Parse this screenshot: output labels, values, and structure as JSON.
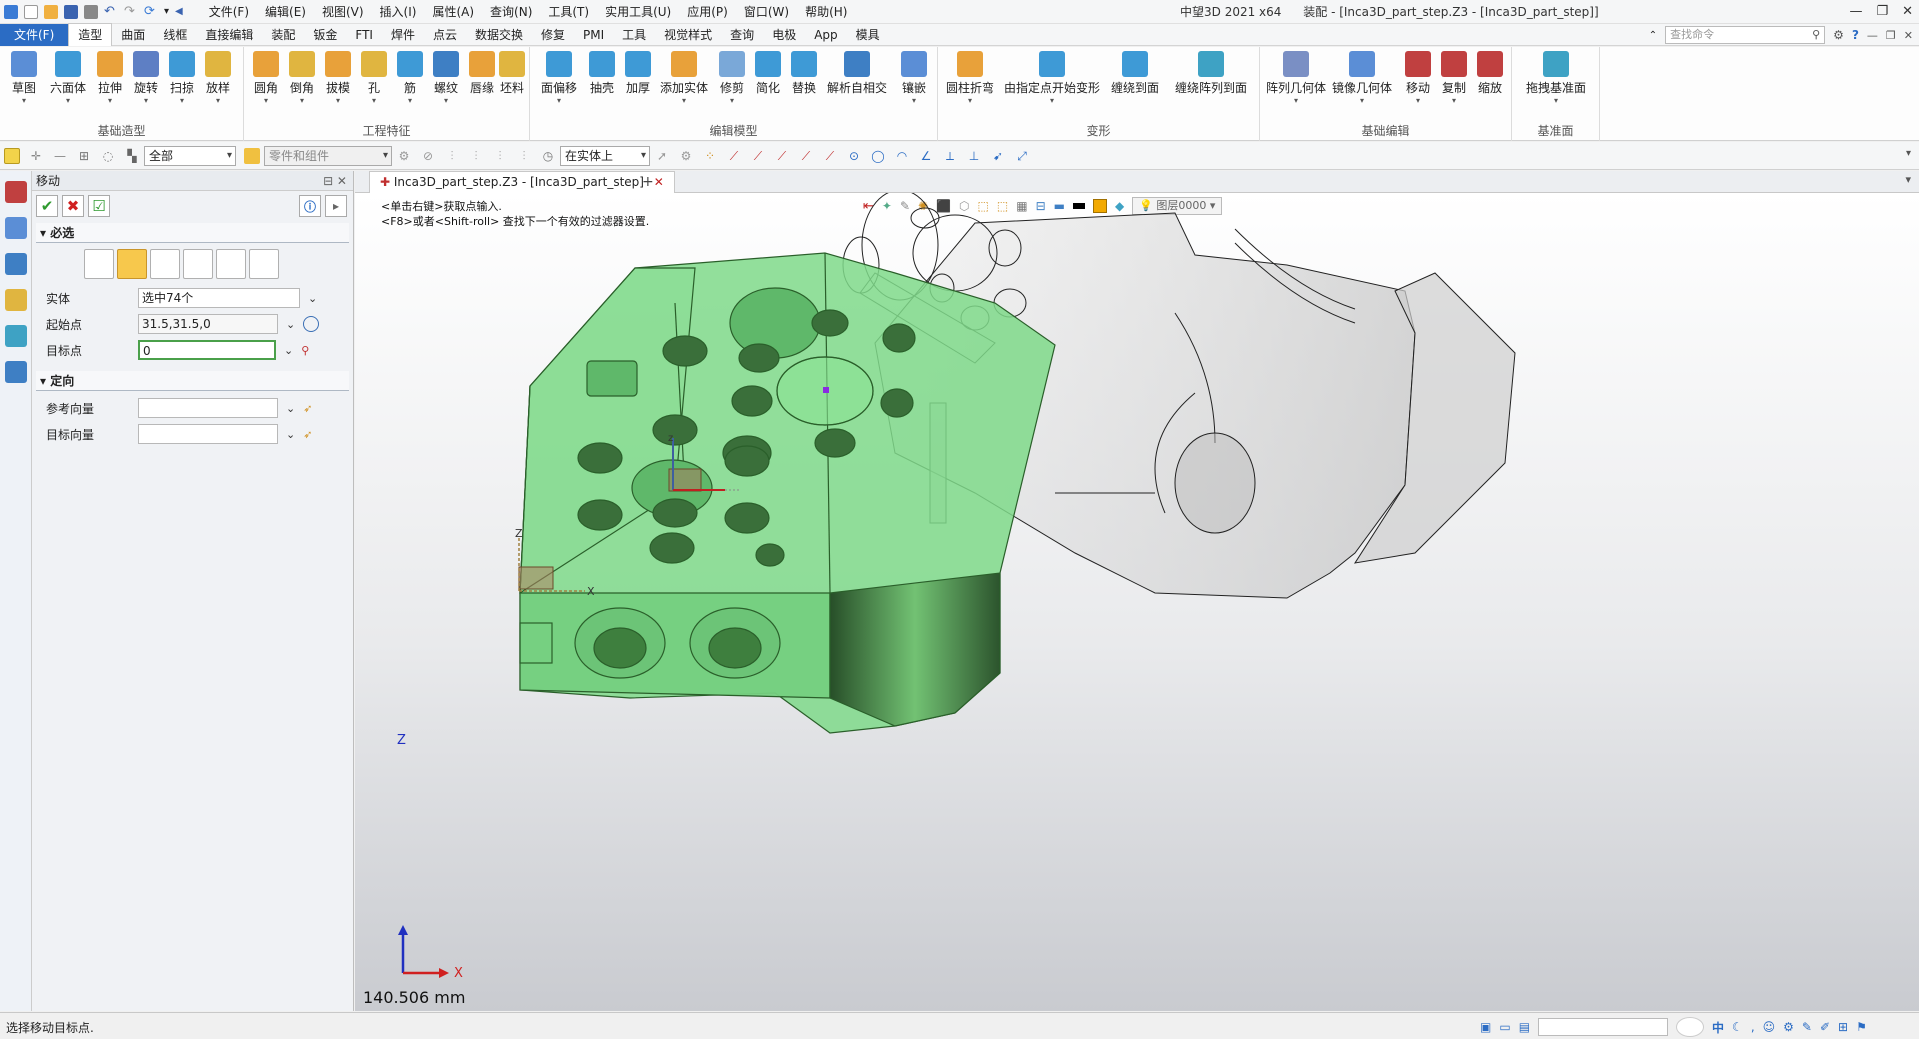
{
  "app": {
    "title": "中望3D 2021 x64",
    "context": "装配 - [Inca3D_part_step.Z3 - [Inca3D_part_step]]"
  },
  "menus": [
    "文件(F)",
    "编辑(E)",
    "视图(V)",
    "插入(I)",
    "属性(A)",
    "查询(N)",
    "工具(T)",
    "实用工具(U)",
    "应用(P)",
    "窗口(W)",
    "帮助(H)"
  ],
  "tabs": {
    "file": "文件(F)",
    "items": [
      "造型",
      "曲面",
      "线框",
      "直接编辑",
      "装配",
      "钣金",
      "FTI",
      "焊件",
      "点云",
      "数据交换",
      "修复",
      "PMI",
      "工具",
      "视觉样式",
      "查询",
      "电极",
      "App",
      "模具"
    ],
    "search_placeholder": "查找命令"
  },
  "ribbon": {
    "groups": [
      {
        "title": "基础造型",
        "buttons": [
          "草图",
          "六面体",
          "拉伸",
          "旋转",
          "扫掠",
          "放样"
        ]
      },
      {
        "title": "工程特征",
        "buttons": [
          "圆角",
          "倒角",
          "拔模",
          "孔",
          "筋",
          "螺纹",
          "唇缘",
          "坯料"
        ]
      },
      {
        "title": "编辑模型",
        "buttons": [
          "面偏移",
          "抽壳",
          "加厚",
          "添加实体",
          "修剪",
          "简化",
          "替换",
          "解析自相交",
          "镶嵌"
        ]
      },
      {
        "title": "变形",
        "buttons": [
          "圆柱折弯",
          "由指定点开始变形",
          "缠绕到面",
          "缠绕阵列到面"
        ]
      },
      {
        "title": "基础编辑",
        "buttons": [
          "阵列几何体",
          "镜像几何体",
          "移动",
          "复制",
          "缩放"
        ]
      },
      {
        "title": "基准面",
        "buttons": [
          "拖拽基准面"
        ]
      }
    ]
  },
  "toolbar2": {
    "filter": "全部",
    "parts": "零件和组件",
    "snap": "在实体上"
  },
  "panel": {
    "title": "移动",
    "required": "必选",
    "orientation": "定向",
    "fields": {
      "entity_label": "实体",
      "entity_value": "选中74个",
      "start_label": "起始点",
      "start_value": "31.5,31.5,0",
      "target_label": "目标点",
      "target_value": "0",
      "ref_vec_label": "参考向量",
      "target_vec_label": "目标向量"
    }
  },
  "doc_tab": "Inca3D_part_step.Z3 - [Inca3D_part_step]",
  "viewport": {
    "prompt1": "<单击右键>获取点输入.",
    "prompt2": "<F8>或者<Shift-roll> 查找下一个有效的过滤器设置.",
    "layer": "图层0000",
    "distance": "140.506 mm",
    "axis_x": "X",
    "axis_z": "Z"
  },
  "status": {
    "text": "选择移动目标点.",
    "ime": "中"
  },
  "colors": {
    "accent": "#2b6cc4",
    "selection_green": "#7fd98a",
    "ok_green": "#2f9a2f",
    "cancel_red": "#d02020"
  }
}
